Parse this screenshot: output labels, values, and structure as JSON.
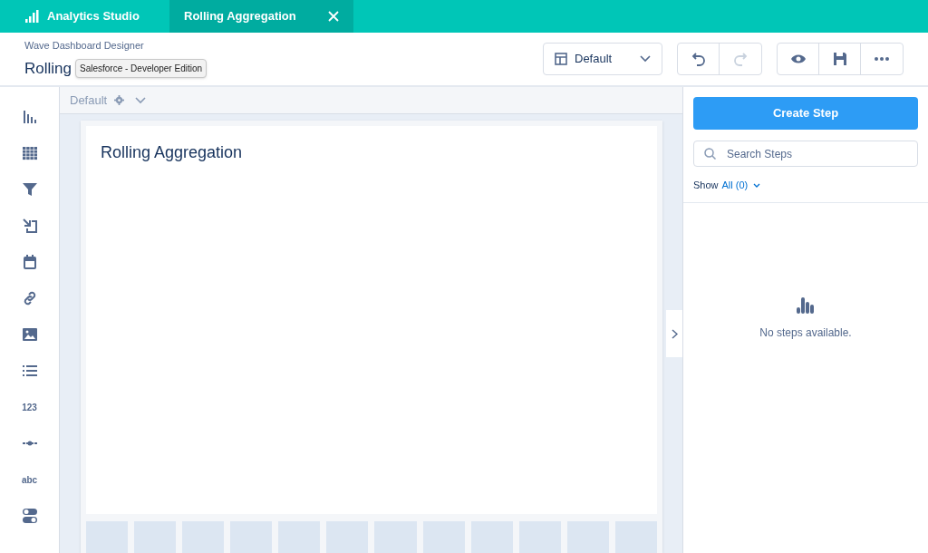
{
  "app_tabs": [
    {
      "label": "Analytics Studio",
      "selected": false,
      "kind": "home"
    },
    {
      "label": "Rolling Aggregation",
      "selected": true,
      "kind": "doc"
    }
  ],
  "header": {
    "subtitle": "Wave Dashboard Designer",
    "title": "Rolling",
    "tooltip": "Salesforce - Developer Edition",
    "layout_select": "Default",
    "redo_disabled": true
  },
  "tools": [
    {
      "kind": "chart"
    },
    {
      "kind": "table"
    },
    {
      "kind": "filter"
    },
    {
      "kind": "import"
    },
    {
      "kind": "calendar"
    },
    {
      "kind": "link"
    },
    {
      "kind": "image"
    },
    {
      "kind": "list"
    },
    {
      "kind": "text",
      "label": "123"
    },
    {
      "kind": "range"
    },
    {
      "kind": "text",
      "label": "abc"
    },
    {
      "kind": "toggle"
    }
  ],
  "canvas": {
    "layout_label": "Default",
    "page_title": "Rolling Aggregation"
  },
  "steps_panel": {
    "create_button": "Create Step",
    "search_placeholder": "Search Steps",
    "show_label": "Show",
    "show_value": "All (0)",
    "empty_message": "No steps available."
  }
}
